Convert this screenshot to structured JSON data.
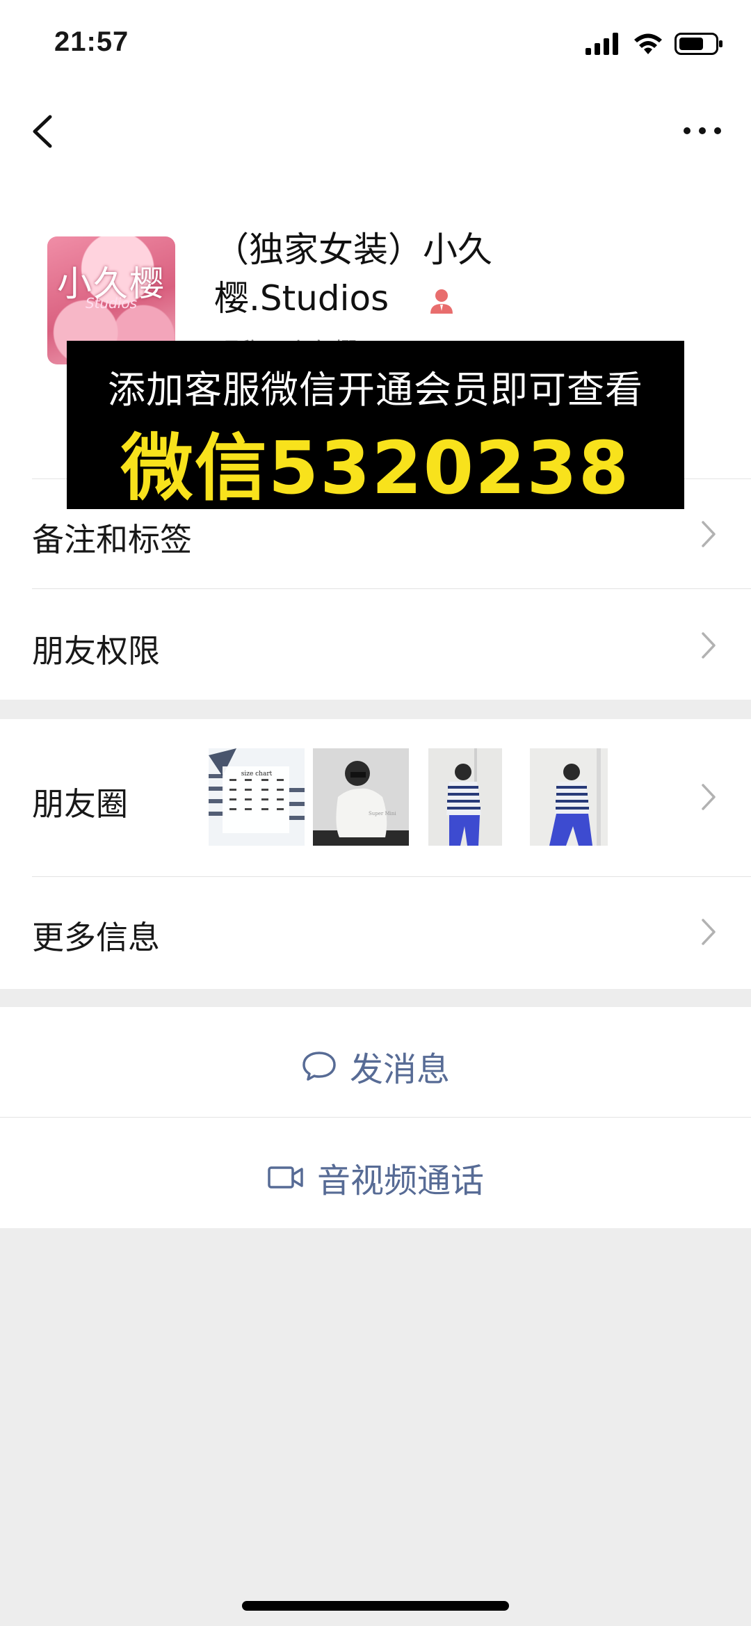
{
  "status_bar": {
    "time": "21:57"
  },
  "profile": {
    "name": "（独家女装）小久樱.Studios",
    "avatar_text": "小久樱",
    "avatar_subtext": "Studios",
    "nick_visible": "昵称：小久樱.Studios"
  },
  "promo_banner": {
    "line1": "添加客服微信开通会员即可查看",
    "line2": "微信5320238",
    "text_color": "#ffffff",
    "highlight_color": "#f8e21c"
  },
  "menu": {
    "remarks_tags": "备注和标签",
    "friend_permissions": "朋友权限",
    "moments": "朋友圈",
    "more_info": "更多信息"
  },
  "moments_thumbs": {
    "thumb1_caption": "size chart",
    "thumb2_caption": "Super Mini"
  },
  "actions": {
    "send_message": "发消息",
    "av_call": "音视频通话",
    "link_color": "#576b95"
  },
  "icons": [
    "signal-icon",
    "wifi-icon",
    "battery-icon",
    "back-arrow-icon",
    "more-icon",
    "person-icon",
    "chevron-right-icon",
    "message-bubble-icon",
    "video-camera-icon"
  ]
}
